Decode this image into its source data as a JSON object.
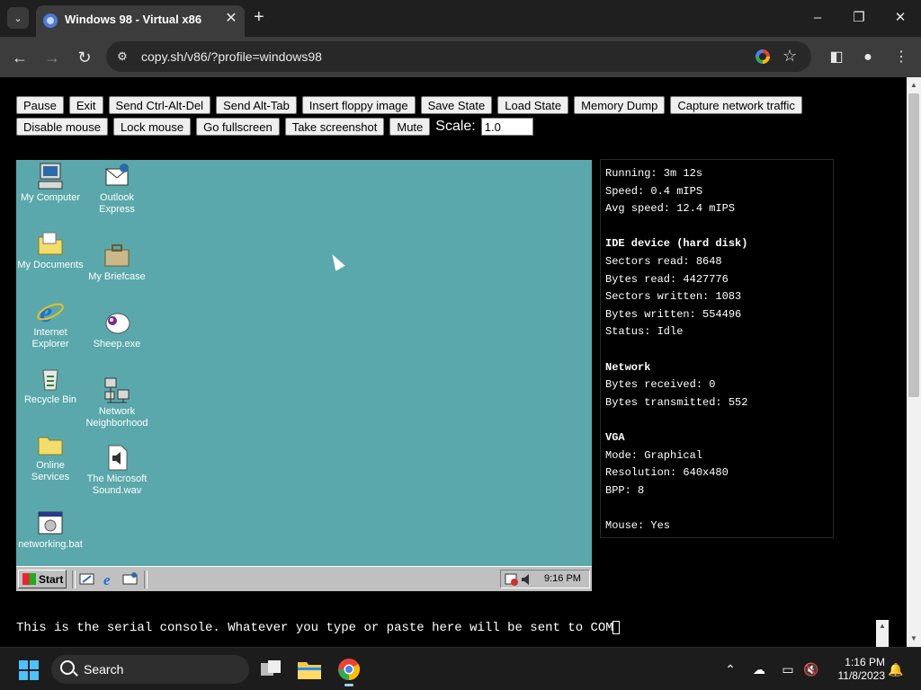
{
  "browser": {
    "tab_title": "Windows 98 - Virtual x86",
    "url": "copy.sh/v86/?profile=windows98"
  },
  "controls": {
    "row1": [
      "Pause",
      "Exit",
      "Send Ctrl-Alt-Del",
      "Send Alt-Tab",
      "Insert floppy image",
      "Save State",
      "Load State",
      "Memory Dump",
      "Capture network traffic"
    ],
    "row2": [
      "Disable mouse",
      "Lock mouse",
      "Go fullscreen",
      "Take screenshot",
      "Mute"
    ],
    "scale_label": "Scale:",
    "scale_value": "1.0"
  },
  "desktop": {
    "icons": [
      {
        "label": "My Computer",
        "icon": "my-computer-icon"
      },
      {
        "label": "Outlook Express",
        "icon": "outlook-express-icon"
      },
      {
        "label": "My Documents",
        "icon": "folder-icon"
      },
      {
        "label": "My Briefcase",
        "icon": "briefcase-icon"
      },
      {
        "label": "Internet Explorer",
        "icon": "internet-explorer-icon"
      },
      {
        "label": "Sheep.exe",
        "icon": "sheep-icon"
      },
      {
        "label": "Recycle Bin",
        "icon": "recycle-bin-icon"
      },
      {
        "label": "Network Neighborhood",
        "icon": "network-icon"
      },
      {
        "label": "Online Services",
        "icon": "folder-icon"
      },
      {
        "label": "The Microsoft Sound.wav",
        "icon": "sound-file-icon"
      },
      {
        "label": "networking.bat",
        "icon": "batch-file-icon"
      }
    ],
    "start_label": "Start",
    "time": "9:16 PM"
  },
  "stats": {
    "running": "Running: 3m 12s",
    "speed": "Speed: 0.4 mIPS",
    "avg_speed": "Avg speed: 12.4 mIPS",
    "ide_title": "IDE device (hard disk)",
    "sectors_read": "Sectors read: 8648",
    "bytes_read": "Bytes read: 4427776",
    "sectors_written": "Sectors written: 1083",
    "bytes_written": "Bytes written: 554496",
    "status": "Status: Idle",
    "network_title": "Network",
    "bytes_received": "Bytes received: 0",
    "bytes_transmitted": "Bytes transmitted: 552",
    "vga_title": "VGA",
    "mode": "Mode: Graphical",
    "resolution": "Resolution: 640x480",
    "bpp": "BPP: 8",
    "mouse": "Mouse: Yes"
  },
  "serial_console": {
    "text": "This is the serial console. Whatever you type or paste here will be sent to COM"
  },
  "windows_taskbar": {
    "search_label": "Search",
    "time": "1:16 PM",
    "date": "11/8/2023"
  },
  "colors": {
    "desktop_teal": "#5aa8ab",
    "chrome_dark": "#1f1f1f",
    "toolbar": "#3c3c3c"
  }
}
